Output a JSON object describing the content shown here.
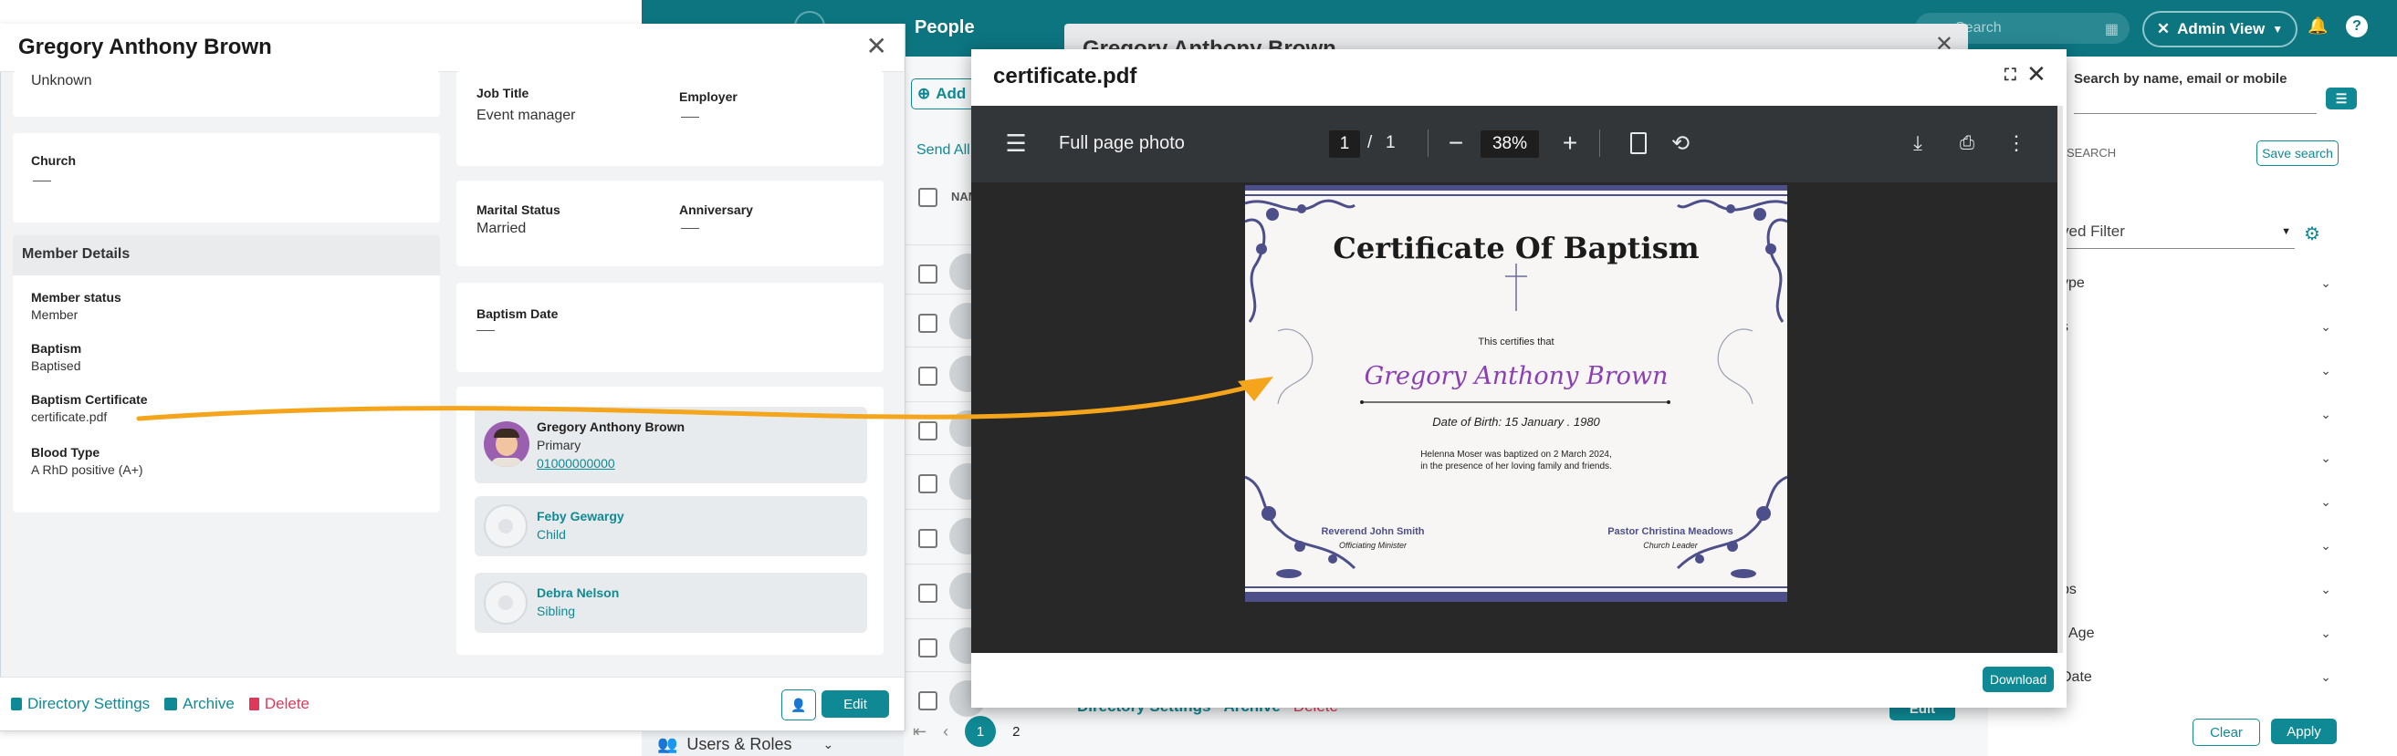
{
  "background_app": {
    "title": "People",
    "search_placeholder": "Search",
    "admin_view_label": "Admin View",
    "modal_title_partial": "Gregory Anthony Brown",
    "add_button_partial": "Add",
    "send_all_partial": "Send All",
    "name_column_partial": "NAM",
    "search_by_label": "Search by name, email or mobile",
    "search_section_label": "SEARCH",
    "save_search_label": "Save search",
    "saved_filter_partial": "ved Filter",
    "filters": [
      "ype",
      "s",
      "",
      "",
      "",
      "",
      "",
      "ps",
      "/ Age",
      "Date"
    ],
    "clear_label": "Clear",
    "apply_label": "Apply",
    "pagination": [
      "1",
      "2"
    ],
    "footer_nav_label": "Users & Roles",
    "footer_directory_settings": "Directory Settings",
    "footer_archive": "Archive",
    "footer_delete": "Delete",
    "footer_edit": "Edit"
  },
  "member_panel": {
    "title": "Gregory Anthony Brown",
    "top_value": "Unknown",
    "church_label": "Church",
    "job_title_label": "Job Title",
    "job_title_value": "Event manager",
    "employer_label": "Employer",
    "marital_status_label": "Marital Status",
    "marital_status_value": "Married",
    "anniversary_label": "Anniversary",
    "baptism_date_label": "Baptism Date",
    "member_details_heading": "Member Details",
    "details": [
      {
        "label": "Member status",
        "value": "Member"
      },
      {
        "label": "Baptism",
        "value": "Baptised"
      },
      {
        "label": "Baptism Certificate",
        "value": "certificate.pdf"
      },
      {
        "label": "Blood Type",
        "value": "A RhD positive (A+)"
      }
    ],
    "relations": [
      {
        "name": "Gregory Anthony Brown",
        "role": "Primary",
        "phone": "01000000000"
      },
      {
        "name": "Feby Gewargy",
        "role": "Child"
      },
      {
        "name": "Debra Nelson",
        "role": "Sibling"
      }
    ],
    "footer": {
      "directory_settings": "Directory Settings",
      "archive": "Archive",
      "delete": "Delete",
      "edit": "Edit"
    }
  },
  "pdf_viewer": {
    "file_name": "certificate.pdf",
    "toolbar_title": "Full page photo",
    "current_page": "1",
    "page_separator": "/",
    "total_pages": "1",
    "zoom": "38%",
    "download_label": "Download"
  },
  "certificate": {
    "title": "Certificate Of Baptism",
    "intro": "This certifies that",
    "name": "Gregory Anthony Brown",
    "dob": "Date of Birth: 15 January . 1980",
    "statement_line1": "Helenna Moser was baptized on 2 March 2024,",
    "statement_line2": "in the presence of her loving family and friends.",
    "sign_left_name": "Reverend John Smith",
    "sign_left_role": "Officiating Minister",
    "sign_right_name": "Pastor Christina Meadows",
    "sign_right_role": "Church Leader"
  },
  "colors": {
    "teal": "#0f8a95",
    "topbar": "#0c7580",
    "annotation_arrow": "#f5a51c",
    "delete_red": "#e0385a",
    "certificate_purple": "#8a3fb5",
    "certificate_border": "#4d4f8a"
  }
}
